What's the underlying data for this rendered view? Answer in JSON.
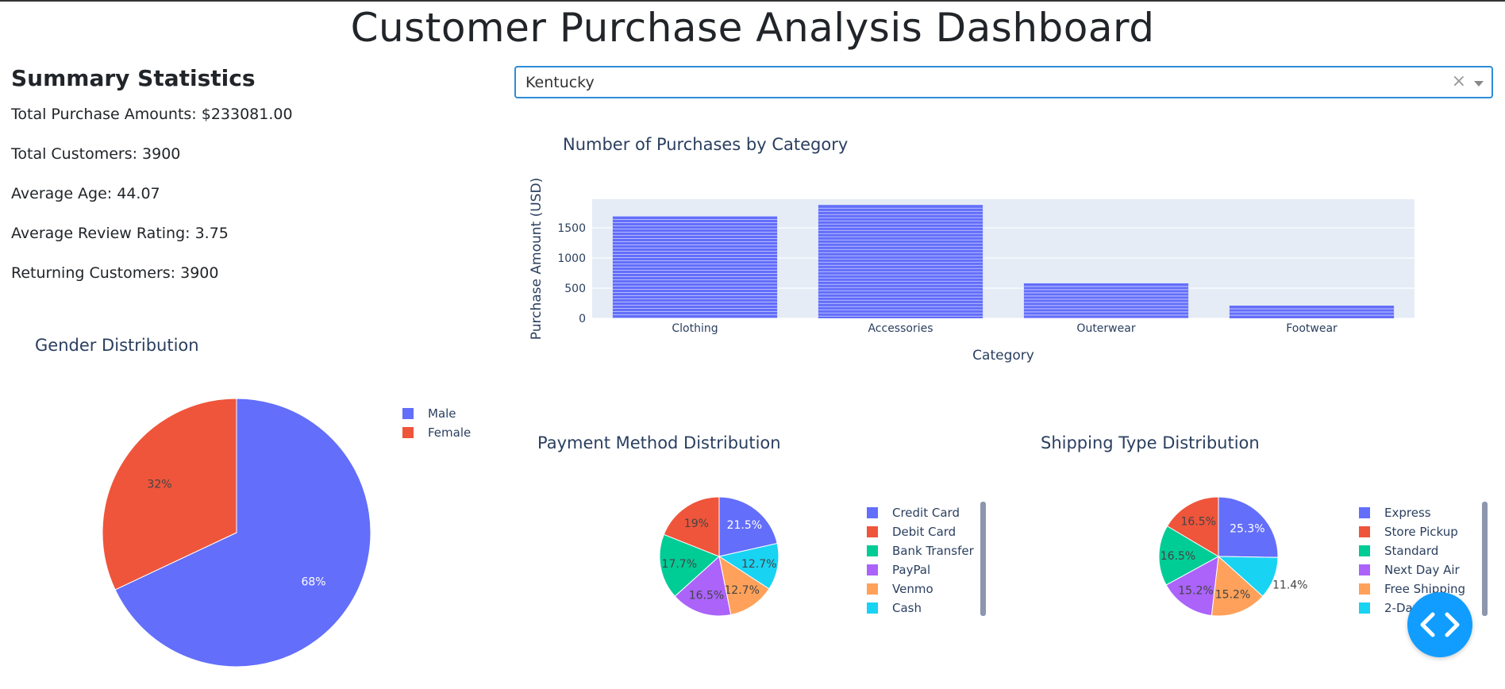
{
  "header": {
    "title": "Customer Purchase Analysis Dashboard"
  },
  "summary": {
    "heading": "Summary Statistics",
    "total_purchase": "Total Purchase Amounts: $233081.00",
    "total_customers": "Total Customers: 3900",
    "average_age": "Average Age: 44.07",
    "average_rating": "Average Review Rating: 3.75",
    "returning_customers": "Returning Customers: 3900"
  },
  "location_dropdown": {
    "value": "Kentucky",
    "clear_symbol": "×"
  },
  "colors": {
    "blue": "#636efa",
    "red": "#ef553b",
    "green": "#00cc96",
    "purple": "#ab63fa",
    "orange": "#ffa15a",
    "cyan": "#19d3f3",
    "plot_bg": "#e5ecf6",
    "title_text": "#2a3f5f",
    "fab": "#119dff"
  },
  "chart_data": [
    {
      "type": "bar",
      "title": "Number of Purchases by Category",
      "xlabel": "Category",
      "ylabel": "Purchase Amount (USD)",
      "categories": [
        "Clothing",
        "Accessories",
        "Outerwear",
        "Footwear"
      ],
      "values": [
        1690,
        1880,
        580,
        210
      ],
      "yticks": [
        0,
        500,
        1000,
        1500
      ],
      "ylim": [
        0,
        2000
      ],
      "grid": true
    },
    {
      "type": "pie",
      "title": "Gender Distribution",
      "labels": [
        "Male",
        "Female"
      ],
      "values": [
        68,
        32
      ],
      "text_labels": [
        "68%",
        "32%"
      ],
      "colors": [
        "#636efa",
        "#ef553b"
      ],
      "legend": "top-right"
    },
    {
      "type": "pie",
      "title": "Payment Method Distribution",
      "labels": [
        "Credit Card",
        "Debit Card",
        "Bank Transfer",
        "PayPal",
        "Venmo",
        "Cash"
      ],
      "values": [
        21.5,
        19,
        17.7,
        16.5,
        12.7,
        12.7
      ],
      "slice_order": [
        0,
        5,
        4,
        3,
        2,
        1
      ],
      "text_labels": [
        "21.5%",
        "12.7%",
        "12.7%",
        "16.5%",
        "17.7%",
        "19%"
      ],
      "colors": [
        "#636efa",
        "#19d3f3",
        "#ffa15a",
        "#ab63fa",
        "#00cc96",
        "#ef553b"
      ],
      "legend": "right"
    },
    {
      "type": "pie",
      "title": "Shipping Type Distribution",
      "labels": [
        "Express",
        "Store Pickup",
        "Standard",
        "Next Day Air",
        "Free Shipping",
        "2-Day Shipping"
      ],
      "legend_visible": [
        "Express",
        "Store Pickup",
        "Standard",
        "Next Day Air",
        "Free Shipping",
        "2-Day"
      ],
      "slice_values": [
        25.3,
        11.4,
        15.2,
        15.2,
        16.5,
        16.5
      ],
      "text_labels": [
        "25.3%",
        "11.4%",
        "15.2%",
        "15.2%",
        "16.5%",
        "16.5%"
      ],
      "colors": [
        "#636efa",
        "#19d3f3",
        "#ffa15a",
        "#ab63fa",
        "#00cc96",
        "#ef553b"
      ],
      "legend": "right"
    }
  ]
}
